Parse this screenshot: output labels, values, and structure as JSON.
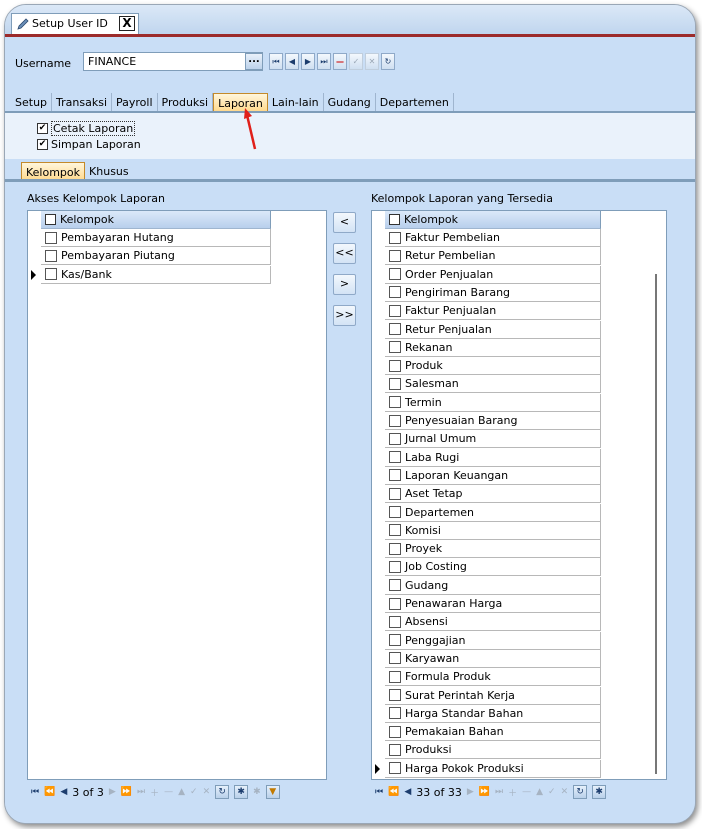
{
  "window": {
    "tab_title": "Setup User ID",
    "close_glyph": "X"
  },
  "user": {
    "label": "Username",
    "value": "FINANCE",
    "lookup_button": "...",
    "nav_buttons": [
      {
        "icon": "first-record-icon",
        "glyph": "⏮",
        "enabled": true
      },
      {
        "icon": "prev-record-icon",
        "glyph": "◀",
        "enabled": true
      },
      {
        "icon": "next-record-icon",
        "glyph": "▶",
        "enabled": true
      },
      {
        "icon": "last-record-icon",
        "glyph": "⏭",
        "enabled": true
      },
      {
        "icon": "delete-record-icon",
        "glyph": "—",
        "enabled": true
      },
      {
        "icon": "post-edit-icon",
        "glyph": "✓",
        "enabled": false
      },
      {
        "icon": "cancel-edit-icon",
        "glyph": "✕",
        "enabled": false
      },
      {
        "icon": "refresh-icon",
        "glyph": "↻",
        "enabled": true
      }
    ]
  },
  "main_tabs": [
    "Setup",
    "Transaksi",
    "Payroll",
    "Produksi",
    "Laporan",
    "Lain-lain",
    "Gudang",
    "Departemen"
  ],
  "main_tab_active": "Laporan",
  "report_checks": [
    {
      "label": "Cetak Laporan",
      "checked": true
    },
    {
      "label": "Simpan Laporan",
      "checked": true
    }
  ],
  "sub_tabs": [
    "Kelompok",
    "Khusus"
  ],
  "sub_tab_active": "Kelompok",
  "left_panel": {
    "title": "Akses Kelompok Laporan",
    "column": "Kelompok",
    "rows": [
      "Pembayaran Hutang",
      "Pembayaran Piutang",
      "Kas/Bank"
    ],
    "current_row": 2,
    "record_text": "3 of 3"
  },
  "right_panel": {
    "title": "Kelompok Laporan yang Tersedia",
    "column": "Kelompok",
    "rows": [
      "Faktur Pembelian",
      "Retur Pembelian",
      "Order Penjualan",
      "Pengiriman Barang",
      "Faktur Penjualan",
      "Retur Penjualan",
      "Rekanan",
      "Produk",
      "Salesman",
      "Termin",
      "Penyesuaian Barang",
      "Jurnal Umum",
      "Laba Rugi",
      "Laporan Keuangan",
      "Aset Tetap",
      "Departemen",
      "Komisi",
      "Proyek",
      "Job Costing",
      "Gudang",
      "Penawaran Harga",
      "Absensi",
      "Penggajian",
      "Karyawan",
      "Formula Produk",
      "Surat Perintah Kerja",
      "Harga Standar Bahan",
      "Pemakaian Bahan",
      "Produksi",
      "Harga Pokok Produksi"
    ],
    "current_row": 29,
    "record_text": "33 of 33"
  },
  "move_buttons": [
    "<",
    "<<",
    ">",
    ">>"
  ],
  "colors": {
    "accent_tab": "#ffd88a",
    "arrow": "#e0201a",
    "frame_bg": "#c9def6"
  }
}
